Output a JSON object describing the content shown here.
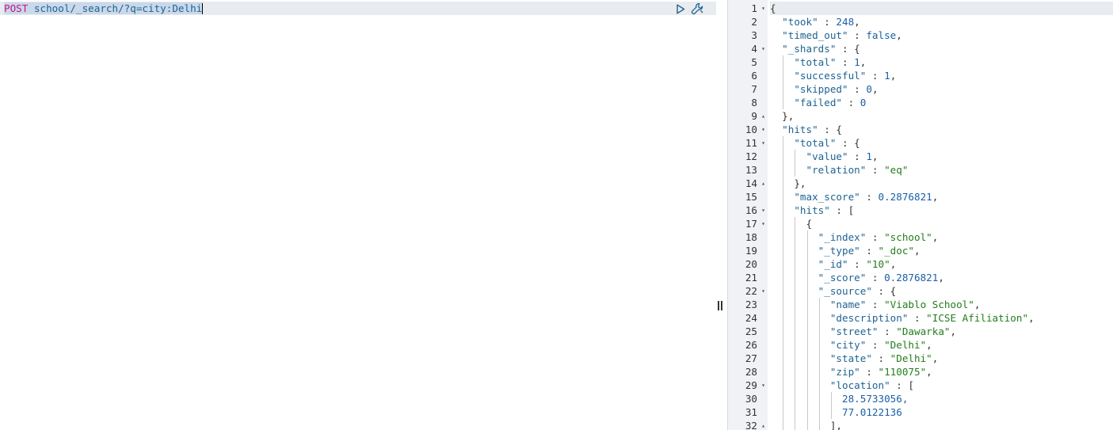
{
  "request": {
    "method": "POST",
    "path": "school/_search/?q=city:Delhi"
  },
  "icons": {
    "run": "play-triangle-icon",
    "settings": "wrench-icon",
    "resizer": "pane-resize-handle"
  },
  "colors": {
    "key": "#1f6392",
    "string": "#237d1c",
    "number": "#1a5fa8",
    "method": "#c71585",
    "gutter_bg": "#f0f2f5",
    "active_line": "#e8ebef"
  },
  "response": {
    "line_numbers": [
      "1",
      "2",
      "3",
      "4",
      "5",
      "6",
      "7",
      "8",
      "9",
      "10",
      "11",
      "12",
      "13",
      "14",
      "15",
      "16",
      "17",
      "18",
      "19",
      "20",
      "21",
      "22",
      "23",
      "24",
      "25",
      "26",
      "27",
      "28",
      "29",
      "30",
      "31",
      "32"
    ],
    "lines": [
      {
        "text": "{",
        "fold": "down"
      },
      {
        "key": "\"took\"",
        "value": "248",
        "type": "n",
        "comma": ","
      },
      {
        "key": "\"timed_out\"",
        "value": "false",
        "type": "b",
        "comma": ","
      },
      {
        "key": "\"_shards\"",
        "value": "{",
        "type": "p",
        "comma": "",
        "fold": "down"
      },
      {
        "key": "\"total\"",
        "value": "1",
        "type": "n",
        "comma": ","
      },
      {
        "key": "\"successful\"",
        "value": "1",
        "type": "n",
        "comma": ","
      },
      {
        "key": "\"skipped\"",
        "value": "0",
        "type": "n",
        "comma": ","
      },
      {
        "key": "\"failed\"",
        "value": "0",
        "type": "n",
        "comma": ""
      },
      {
        "text": "},",
        "fold": "up"
      },
      {
        "key": "\"hits\"",
        "value": "{",
        "type": "p",
        "comma": "",
        "fold": "down"
      },
      {
        "key": "\"total\"",
        "value": "{",
        "type": "p",
        "comma": "",
        "fold": "down"
      },
      {
        "key": "\"value\"",
        "value": "1",
        "type": "n",
        "comma": ","
      },
      {
        "key": "\"relation\"",
        "value": "\"eq\"",
        "type": "s",
        "comma": ""
      },
      {
        "text": "},",
        "fold": "up"
      },
      {
        "key": "\"max_score\"",
        "value": "0.2876821",
        "type": "n",
        "comma": ","
      },
      {
        "key": "\"hits\"",
        "value": "[",
        "type": "p",
        "comma": "",
        "fold": "down"
      },
      {
        "text": "{",
        "fold": "down"
      },
      {
        "key": "\"_index\"",
        "value": "\"school\"",
        "type": "s",
        "comma": ","
      },
      {
        "key": "\"_type\"",
        "value": "\"_doc\"",
        "type": "s",
        "comma": ","
      },
      {
        "key": "\"_id\"",
        "value": "\"10\"",
        "type": "s",
        "comma": ","
      },
      {
        "key": "\"_score\"",
        "value": "0.2876821",
        "type": "n",
        "comma": ","
      },
      {
        "key": "\"_source\"",
        "value": "{",
        "type": "p",
        "comma": "",
        "fold": "down"
      },
      {
        "key": "\"name\"",
        "value": "\"Viablo School\"",
        "type": "s",
        "comma": ","
      },
      {
        "key": "\"description\"",
        "value": "\"ICSE Afiliation\"",
        "type": "s",
        "comma": ","
      },
      {
        "key": "\"street\"",
        "value": "\"Dawarka\"",
        "type": "s",
        "comma": ","
      },
      {
        "key": "\"city\"",
        "value": "\"Delhi\"",
        "type": "s",
        "comma": ","
      },
      {
        "key": "\"state\"",
        "value": "\"Delhi\"",
        "type": "s",
        "comma": ","
      },
      {
        "key": "\"zip\"",
        "value": "\"110075\"",
        "type": "s",
        "comma": ","
      },
      {
        "key": "\"location\"",
        "value": "[",
        "type": "p",
        "comma": "",
        "fold": "down"
      },
      {
        "text": "28.5733056,",
        "type": "n"
      },
      {
        "text": "77.0122136",
        "type": "n"
      },
      {
        "text": "],",
        "fold": "up"
      }
    ]
  }
}
